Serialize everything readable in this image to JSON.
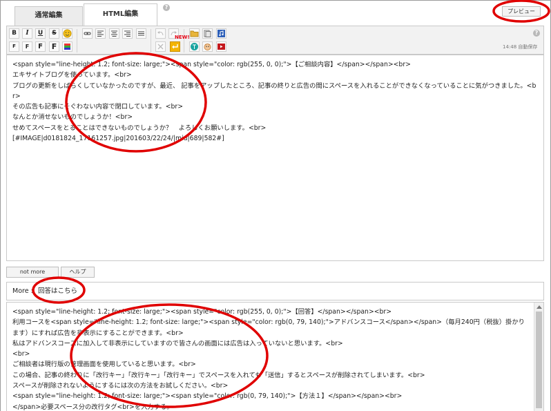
{
  "tabs": [
    {
      "label": "通常編集"
    },
    {
      "label": "HTML編集"
    }
  ],
  "help_mark": "?",
  "preview_button": "プレビュー",
  "toolbar": {
    "bold": "B",
    "italic": "I",
    "underline": "U",
    "strike": "S",
    "font_small": "F",
    "font_medium": "F",
    "font_large": "F",
    "new_badge": "NEW!",
    "autosave": "14:48 自動保存",
    "help": "?"
  },
  "editor_main": {
    "lines": [
      "<span style=\"line-height: 1.2; font-size: large;\"><span style=\"color: rgb(255, 0, 0);\">【ご相談内容】</span></span><br>",
      "エキサイトブログを使っています。<br>",
      "ブログの更新をしばらくしていなかったのですが、最近、 記事をアップしたところ、記事の終りと広告の間にスペースを入れることができなくなっていることに気がつきました。<br>",
      "その広告も記事にそぐわない内容で閉口しています。<br>",
      "なんとか消せないものでしょうか！<br>",
      "せめてスペースをとることはできないものでしょうか？　よろしくお願いします。<br>",
      "[#IMAGE|d0181824_17161257.jpg|201603/22/24/|mid|689|582#]"
    ]
  },
  "buttons": {
    "not_more": "not more",
    "help": "ヘルプ"
  },
  "more": {
    "label": "More :",
    "value": "回答はこちら"
  },
  "editor_more": {
    "lines": [
      "<span style=\"line-height: 1.2; font-size: large;\"><span style=\"color: rgb(255, 0, 0);\">【回答】</span></span><br>",
      "利用コースを<span style=\"line-height: 1.2; font-size: large;\"><span style=\"color: rgb(0, 79, 140);\">アドバンスコース</span></span>（毎月240円（税抜）掛かります）にすれば広告を非表示にすることができます。<br>",
      "私はアドバンスコースに加入して非表示にしていますので皆さんの画面には広告は入っていないと思います。<br>",
      "<br>",
      "ご相談者は現行版の管理画面を使用していると思います。<br>",
      "この場合、記事の終わりに「改行キー」「改行キー」「改行キー」でスペースを入れても「送信」するとスペースが削除されてしまいます。<br>",
      "スペースが削除されないようにするには次の方法をお試しください。<br>",
      "<span style=\"line-height: 1.2; font-size: large;\"><span style=\"color: rgb(0, 79, 140);\">【方法１】</span></span><br>",
      "</span>必要スペース分の改行タグ<br>を入力する。"
    ]
  },
  "colors": {
    "annotation": "#e00000",
    "text_color_swatch": "#ffcc00"
  }
}
